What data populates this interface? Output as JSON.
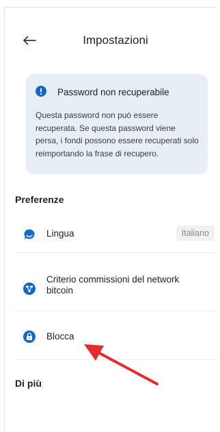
{
  "header": {
    "title": "Impostazioni",
    "back_icon": "arrow-left-icon"
  },
  "notice": {
    "icon": "info-icon",
    "title": "Password non recuperabile",
    "body": "Questa password non può essere recuperata. Se questa password viene persa, i fondi possono essere recuperati solo reimportando la frase di recupero."
  },
  "preferences": {
    "section_title": "Preferenze",
    "items": [
      {
        "icon": "chat-bubble-icon",
        "label": "Lingua",
        "value": "Italiano"
      },
      {
        "icon": "fee-network-icon",
        "label": "Criterio commissioni del network bitcoin"
      },
      {
        "icon": "lock-icon",
        "label": "Blocca"
      }
    ]
  },
  "more": {
    "section_title": "Di più"
  },
  "colors": {
    "accent": "#1668c7",
    "notice_bg": "#e7eef6",
    "annotation_arrow": "#e52b2b"
  }
}
